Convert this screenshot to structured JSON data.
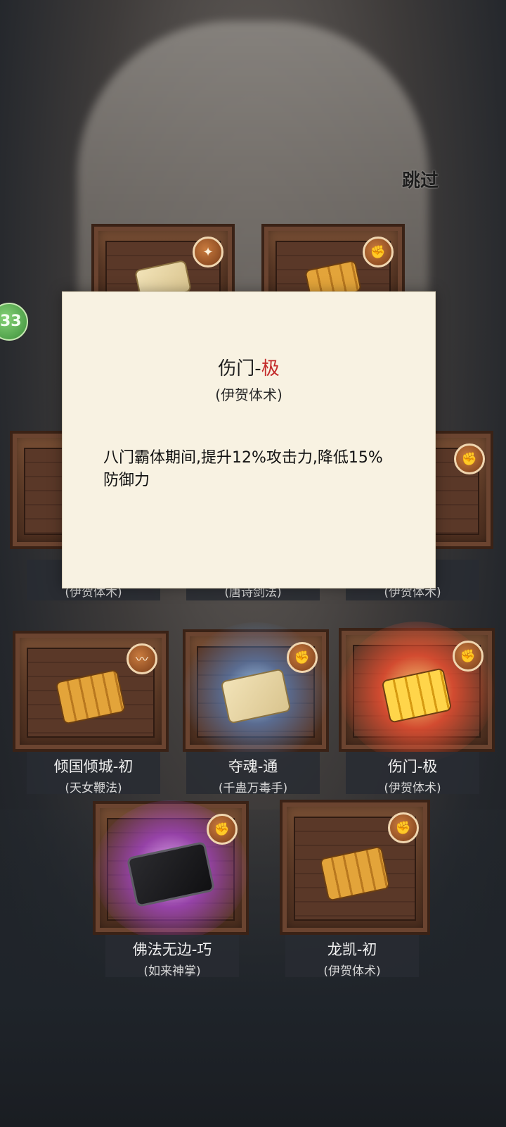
{
  "header": {
    "skip_label": "跳过"
  },
  "side_badge": {
    "value": "33"
  },
  "partial_labels": [
    {
      "school": "(伊贺体术)"
    },
    {
      "school": "(唐诗剑法)"
    },
    {
      "school": "(伊贺体术)"
    }
  ],
  "cards": [
    {
      "name": "倾国倾城-初",
      "school": "(天女鞭法)",
      "glow": "none",
      "icon": "whip-icon"
    },
    {
      "name": "夺魂-通",
      "school": "(千蛊万毒手)",
      "glow": "blue",
      "icon": "fist-icon"
    },
    {
      "name": "伤门-极",
      "school": "(伊贺体术)",
      "glow": "red",
      "icon": "fist-icon"
    },
    {
      "name": "佛法无边-巧",
      "school": "(如来神掌)",
      "glow": "purple",
      "icon": "fist-icon"
    },
    {
      "name": "龙凯-初",
      "school": "(伊贺体术)",
      "glow": "none",
      "icon": "fist-icon"
    }
  ],
  "dialog": {
    "title_prefix": "伤门-",
    "title_grade": "极",
    "grade_color": "#c32a2a",
    "subtitle": "(伊贺体术)",
    "description": "八门霸体期间,提升12%攻击力,降低15%防御力"
  }
}
